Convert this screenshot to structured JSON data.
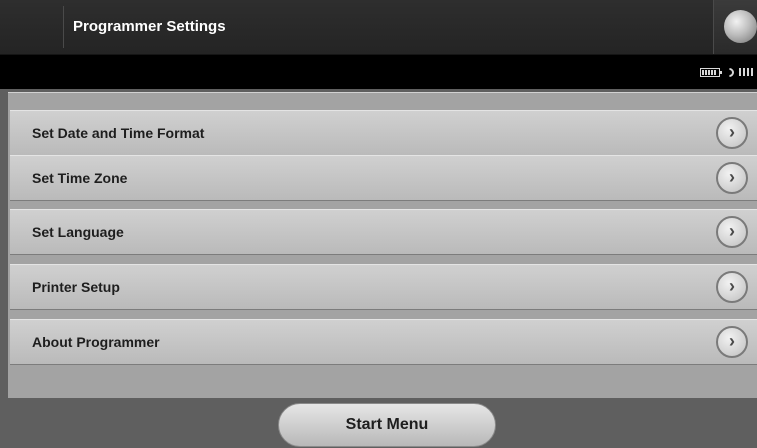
{
  "header": {
    "title": "Programmer Settings",
    "corner_icon": "globe-icon"
  },
  "status_bar": {
    "icons": [
      "battery-icon",
      "wifi-icon",
      "signal-icon"
    ]
  },
  "menu": {
    "items": [
      {
        "label": "Set Date and Time Format",
        "icon": "chevron-right-icon"
      },
      {
        "label": "Set Time Zone",
        "icon": "chevron-right-icon"
      },
      {
        "label": "Set Language",
        "icon": "chevron-right-icon"
      },
      {
        "label": "Printer Setup",
        "icon": "chevron-right-icon"
      },
      {
        "label": "About Programmer",
        "icon": "chevron-right-icon"
      }
    ],
    "chevron_glyph": "›"
  },
  "footer": {
    "start_label": "Start Menu"
  },
  "colors": {
    "title_bar": "#2a2a2a",
    "status_bar": "#000000",
    "panel": "#a3a3a3",
    "background": "#5f5f5f"
  }
}
